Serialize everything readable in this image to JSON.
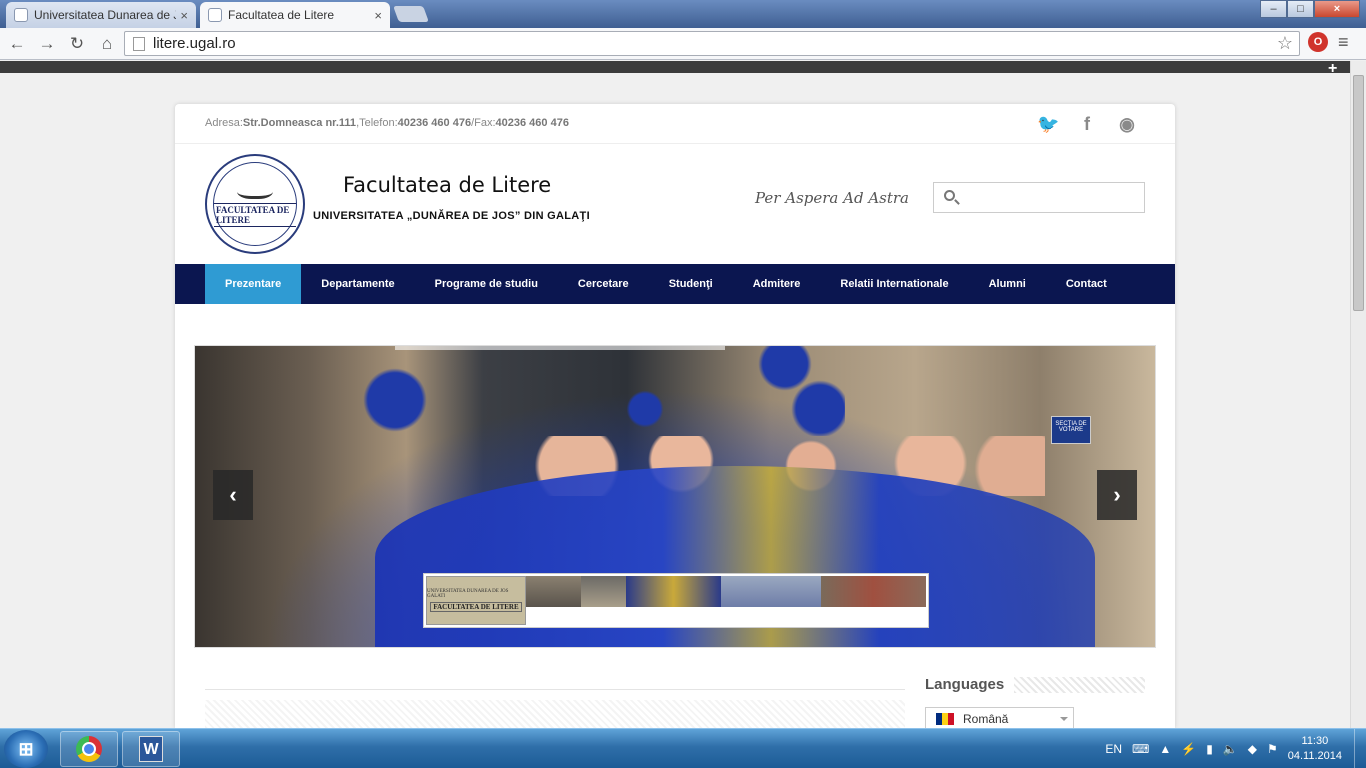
{
  "browser": {
    "tabs": [
      {
        "title": "Universitatea Dunarea de J",
        "active": false
      },
      {
        "title": "Facultatea de Litere",
        "active": true
      }
    ],
    "close_glyph": "×",
    "url": "litere.ugal.ro",
    "nav": {
      "back": "←",
      "forward": "→",
      "reload": "↻",
      "home": "⌂"
    },
    "star": "☆",
    "menu": "≡",
    "extension_label": "O",
    "window_buttons": {
      "minimize": "–",
      "maximize": "□",
      "close": "×"
    }
  },
  "site": {
    "topinfo": {
      "address_label": "Adresa:",
      "address_value": "Str.Domneasca nr.111",
      "phone_label": ",Telefon:",
      "phone_value": "40236 460 476",
      "fax_label": "/Fax:",
      "fax_value": "40236 460 476"
    },
    "social": [
      {
        "icon": "twitter-icon",
        "glyph": "🐦"
      },
      {
        "icon": "facebook-icon",
        "glyph": "f"
      },
      {
        "icon": "rss-icon",
        "glyph": "◉"
      }
    ],
    "logo": {
      "banner": "FACULTATEA DE LITERE"
    },
    "title": "Facultatea de Litere",
    "subtitle": "UNIVERSITATEA  „DUNĂREA DE JOS”  DIN GALAŢI",
    "motto": "Per Aspera Ad Astra",
    "search": {
      "placeholder": ""
    },
    "nav": [
      {
        "label": "Prezentare",
        "active": true
      },
      {
        "label": "Departamente"
      },
      {
        "label": "Programe de studiu"
      },
      {
        "label": "Cercetare"
      },
      {
        "label": "Studenţi"
      },
      {
        "label": "Admitere"
      },
      {
        "label": "Relatii Internationale"
      },
      {
        "label": "Alumni"
      },
      {
        "label": "Contact"
      }
    ],
    "slider": {
      "prev": "‹",
      "next": "›",
      "sign": "SECŢIA DE VOTARE",
      "thumb_caption_small": "UNIVERSITATEA DUNAREA DE JOS GALATI",
      "thumb_caption_big": "FACULTATEA DE LITERE"
    },
    "languages": {
      "heading": "Languages",
      "selected": "Română"
    }
  },
  "colors": {
    "nav_bg": "#0b1650",
    "nav_active": "#2f9bd3",
    "flag_ro": [
      "#002b7f",
      "#fcd116",
      "#ce1126"
    ]
  },
  "taskbar": {
    "start": "⊞",
    "apps": [
      {
        "icon": "chrome-icon"
      },
      {
        "icon": "word-icon",
        "label": "W"
      }
    ],
    "lang": "EN",
    "time": "11:30",
    "date": "04.11.2014"
  }
}
